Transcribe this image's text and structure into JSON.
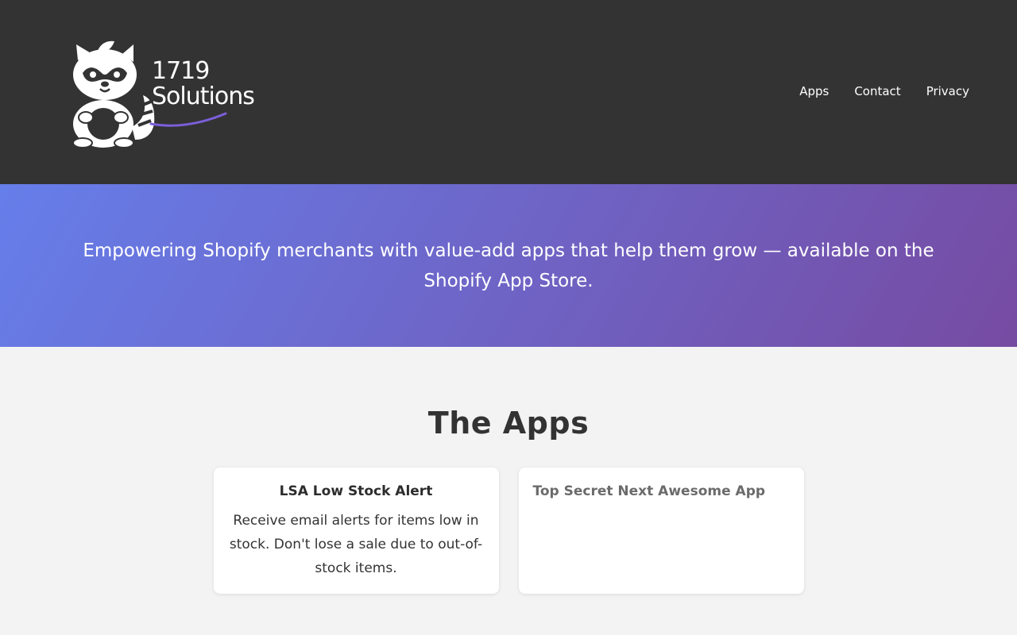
{
  "brand": {
    "line1": "1719",
    "line2": "Solutions",
    "accent_color": "#7b5fd9"
  },
  "nav": {
    "items": [
      {
        "label": "Apps"
      },
      {
        "label": "Contact"
      },
      {
        "label": "Privacy"
      }
    ]
  },
  "hero": {
    "text": "Empowering Shopify merchants with value-add apps that help them grow — available on the Shopify App Store.",
    "gradient_start": "#667eea",
    "gradient_end": "#764ba2"
  },
  "apps": {
    "heading": "The Apps",
    "cards": [
      {
        "title": "LSA Low Stock Alert",
        "description": "Receive email alerts for items low in stock. Don't lose a sale due to out-of-stock items."
      },
      {
        "title": "Top Secret Next Awesome App",
        "description": ""
      }
    ]
  }
}
